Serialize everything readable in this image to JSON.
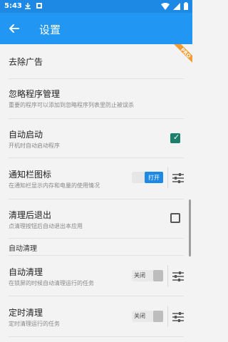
{
  "status": {
    "time": "5:43"
  },
  "appbar": {
    "title": "设置"
  },
  "items": [
    {
      "title": "去除广告",
      "pro": "PRO"
    },
    {
      "title": "忽略程序管理",
      "subtitle": "重要的程序可以添加到忽略程序列表里防止被误杀"
    },
    {
      "title": "自动启动",
      "subtitle": "开机时自动启动程序",
      "checked": true
    },
    {
      "title": "通知栏图标",
      "subtitle": "在通知栏显示内存和电量的使用情况",
      "switch": "打开"
    },
    {
      "title": "清理后退出",
      "subtitle": "点清理按钮后自动退出本应用",
      "checked": false
    }
  ],
  "section": {
    "title": "自动清理"
  },
  "items2": [
    {
      "title": "自动清理",
      "subtitle": "在锁屏的时候自动清理运行的任务",
      "switch": "关闭"
    },
    {
      "title": "定时清理",
      "subtitle": "定时清理运行的任务",
      "switch": "关闭"
    }
  ],
  "colors": {
    "statusbar": "#1e88e5",
    "appbar": "#2196f3",
    "accent": "#1b7f6b",
    "pro_badge": "#f39c32"
  }
}
